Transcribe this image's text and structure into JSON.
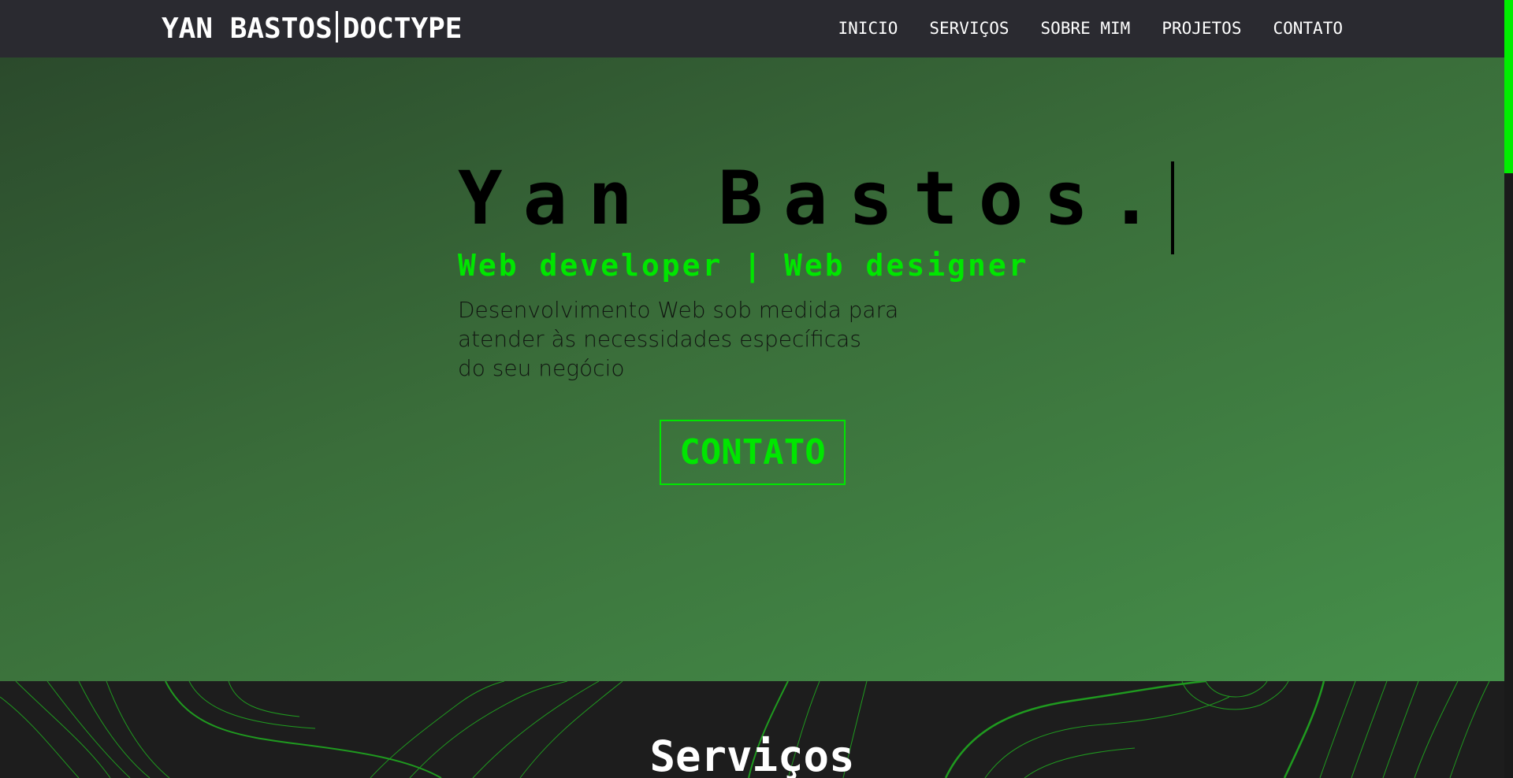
{
  "header": {
    "brand_left": "YAN BASTOS",
    "brand_right": "DOCTYPE",
    "nav": [
      {
        "label": "INICIO"
      },
      {
        "label": "SERVIÇOS"
      },
      {
        "label": "SOBRE MIM"
      },
      {
        "label": "PROJETOS"
      },
      {
        "label": "CONTATO"
      }
    ]
  },
  "hero": {
    "title": "Yan Bastos.",
    "subtitle": "Web developer | Web designer",
    "description_lines": [
      "Desenvolvimento Web sob medida para",
      "atender às necessidades específicas",
      "do seu negócio"
    ],
    "cta_label": "CONTATO"
  },
  "services": {
    "title": "Serviços"
  },
  "colors": {
    "accent": "#00e600",
    "header_bg": "#2a2a30",
    "section_bg": "#1d1d1d",
    "hero_gradient_start": "#2b4a2c",
    "hero_gradient_end": "#45904a"
  }
}
